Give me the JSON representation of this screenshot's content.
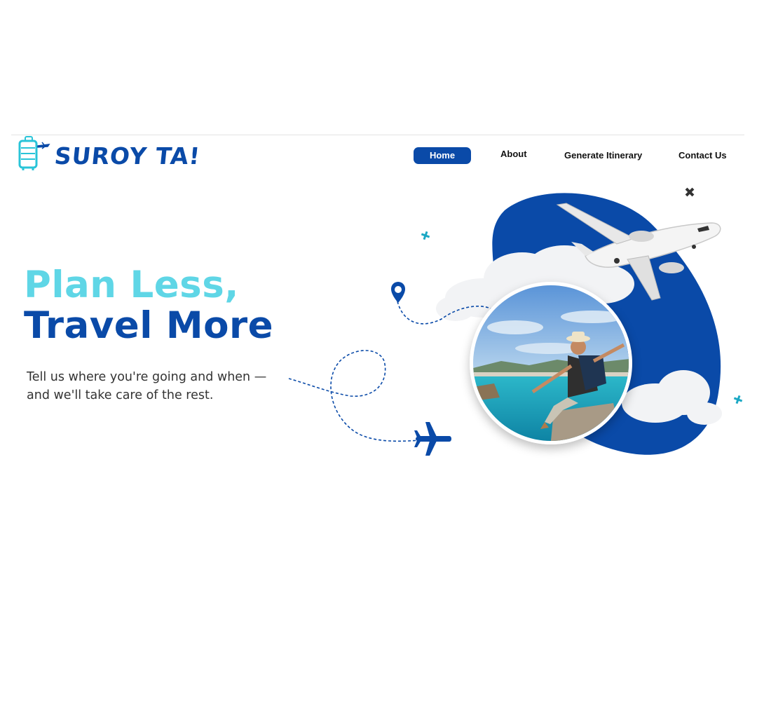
{
  "brand": {
    "name": "SUROY TA!",
    "accent": "#0a4aa8",
    "secondary": "#5fd6e6"
  },
  "nav": {
    "items": [
      {
        "label": "Home",
        "active": true
      },
      {
        "label": "About",
        "active": false
      },
      {
        "label": "Generate Itinerary",
        "active": false
      },
      {
        "label": "Contact Us",
        "active": false
      }
    ]
  },
  "hero": {
    "headline_line1": "Plan Less,",
    "headline_line2": "Travel More",
    "tagline_line1": "Tell us where you're going and when —",
    "tagline_line2": "and we'll take care of the rest."
  },
  "icons": [
    "suitcase-logo-icon",
    "location-pin-icon",
    "airplane-icon",
    "sparkle-icon"
  ]
}
